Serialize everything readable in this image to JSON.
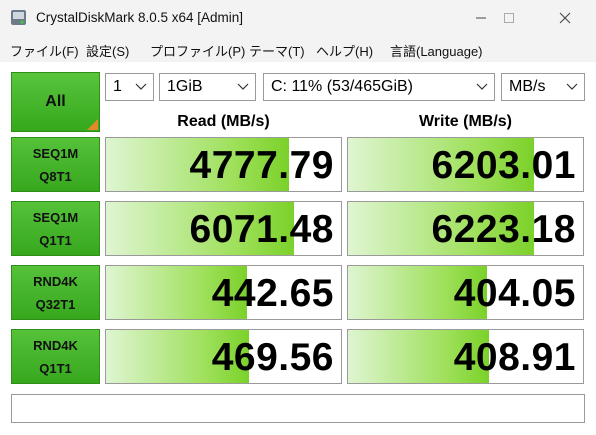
{
  "window": {
    "title": "CrystalDiskMark 8.0.5 x64 [Admin]",
    "minimize_symbol": "—",
    "maximize_symbol": "□",
    "close_symbol": "✕"
  },
  "menu": [
    {
      "label": "ファイル(F)"
    },
    {
      "label": "設定(S)"
    },
    {
      "label": "プロファイル(P)"
    },
    {
      "label": "テーマ(T)"
    },
    {
      "label": "ヘルプ(H)"
    },
    {
      "label": "言語(Language)"
    }
  ],
  "controls": {
    "all_label": "All",
    "count": "1",
    "size": "1GiB",
    "drive": "C: 11% (53/465GiB)",
    "unit": "MB/s"
  },
  "headers": {
    "read": "Read (MB/s)",
    "write": "Write (MB/s)"
  },
  "rows": [
    {
      "line1": "SEQ1M",
      "line2": "Q8T1",
      "read": "4777.79",
      "write": "6203.01",
      "read_fill": 0.78,
      "write_fill": 0.79
    },
    {
      "line1": "SEQ1M",
      "line2": "Q1T1",
      "read": "6071.48",
      "write": "6223.18",
      "read_fill": 0.8,
      "write_fill": 0.79
    },
    {
      "line1": "RND4K",
      "line2": "Q32T1",
      "read": "442.65",
      "write": "404.05",
      "read_fill": 0.6,
      "write_fill": 0.59
    },
    {
      "line1": "RND4K",
      "line2": "Q1T1",
      "read": "469.56",
      "write": "408.91",
      "read_fill": 0.61,
      "write_fill": 0.6
    }
  ],
  "comment": "",
  "colors": {
    "green": "#4cbb30",
    "accent_orange": "#e58a2a"
  }
}
